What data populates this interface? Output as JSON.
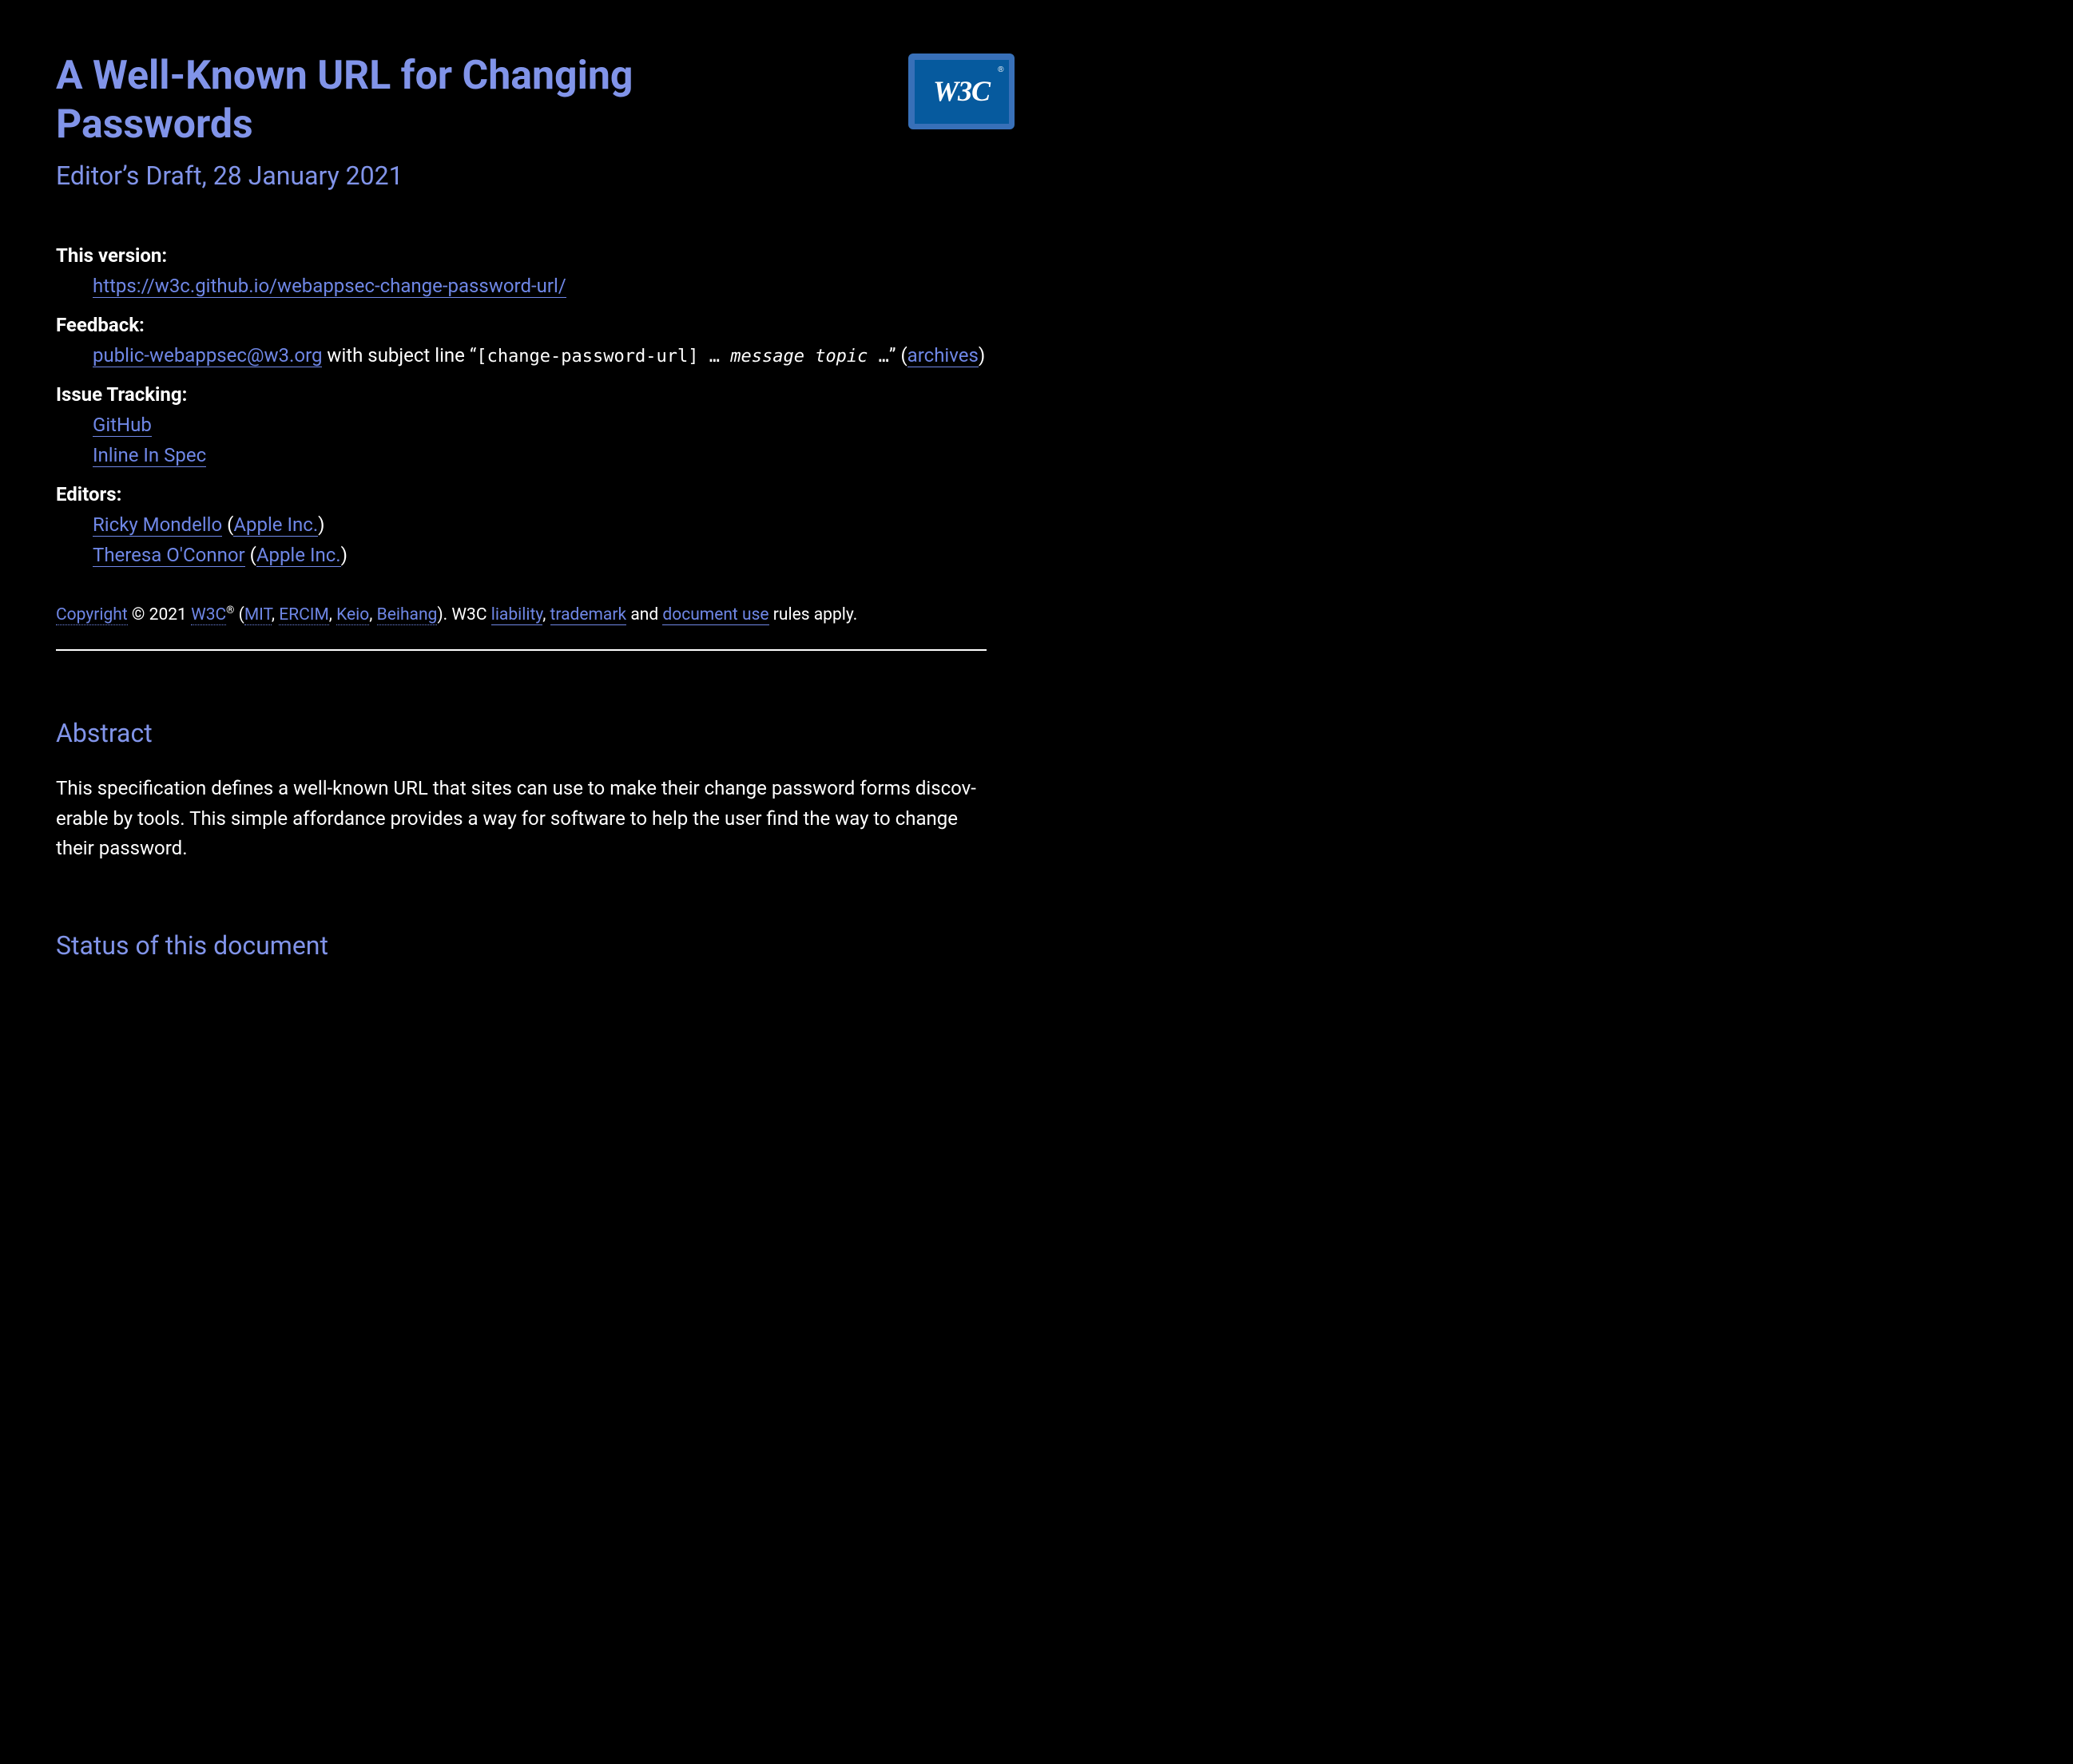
{
  "header": {
    "title": "A Well-Known URL for Changing Passwords",
    "subtitle": "Editor’s Draft, 28 January 2021",
    "logo_text": "W3C",
    "logo_reg": "®"
  },
  "meta": {
    "this_version": {
      "label": "This version:",
      "url_text": "https://w3c.github.io/webappsec-change-password-url/"
    },
    "feedback": {
      "label": "Feedback:",
      "email": "public-webappsec@w3.org",
      "with_text": " with subject line “",
      "mono_prefix": "[change-password-url] ",
      "ellipsis1": "… ",
      "mono_italic": "message topic ",
      "ellipsis2": "…",
      "close_quote_paren": "” (",
      "archives": "archives",
      "close_paren": ")"
    },
    "issue_tracking": {
      "label": "Issue Tracking:",
      "items": [
        "GitHub",
        "Inline In Spec"
      ]
    },
    "editors": {
      "label": "Editors:",
      "list": [
        {
          "name": "Ricky Mondello",
          "org": "Apple Inc."
        },
        {
          "name": "Theresa O'Connor",
          "org": "Apple Inc."
        }
      ]
    }
  },
  "copyright": {
    "copyright_link": "Copyright",
    "year_text": " © 2021 ",
    "w3c": "W3C",
    "sup": "®",
    "open_paren": " (",
    "mit": "MIT",
    "comma1": ", ",
    "ercim": "ERCIM",
    "comma2": ", ",
    "keio": "Keio",
    "comma3": ", ",
    "beihang": "Beihang",
    "close_paren_w3c": "). W3C ",
    "liability": "liability",
    "comma4": ", ",
    "trademark": "trademark",
    "and": " and ",
    "docuse": "document use",
    "rules": " rules apply."
  },
  "sections": {
    "abstract": {
      "heading": "Abstract",
      "body": "This specification defines a well-known URL that sites can use to make their change password forms discov­erable by tools. This simple affordance provides a way for software to help the user find the way to change their password."
    },
    "status": {
      "heading": "Status of this document"
    }
  }
}
